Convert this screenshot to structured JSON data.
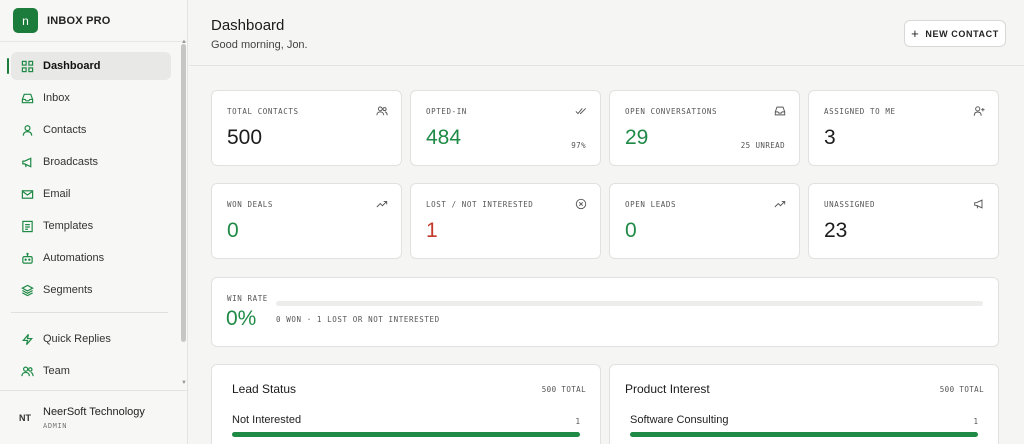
{
  "brand": {
    "logo_letter": "n",
    "name": "INBOX PRO"
  },
  "sidebar": {
    "items": [
      {
        "label": "Dashboard",
        "icon": "grid-icon",
        "active": true
      },
      {
        "label": "Inbox",
        "icon": "inbox-icon"
      },
      {
        "label": "Contacts",
        "icon": "user-icon"
      },
      {
        "label": "Broadcasts",
        "icon": "megaphone-icon"
      },
      {
        "label": "Email",
        "icon": "mail-icon"
      },
      {
        "label": "Templates",
        "icon": "template-icon"
      },
      {
        "label": "Automations",
        "icon": "bot-icon"
      },
      {
        "label": "Segments",
        "icon": "layers-icon"
      },
      {
        "label": "Quick Replies",
        "icon": "zap-icon"
      },
      {
        "label": "Team",
        "icon": "users-icon"
      }
    ],
    "user": {
      "initials": "NT",
      "name": "NeerSoft Technology",
      "role": "ADMIN"
    }
  },
  "header": {
    "title": "Dashboard",
    "greeting": "Good morning, Jon.",
    "new_contact_label": "NEW CONTACT"
  },
  "stats": {
    "total_contacts": {
      "label": "TOTAL CONTACTS",
      "value": "500",
      "icon": "users-icon"
    },
    "opted_in": {
      "label": "OPTED-IN",
      "value": "484",
      "sub": "97%",
      "icon": "double-check-icon"
    },
    "open_conversations": {
      "label": "OPEN CONVERSATIONS",
      "value": "29",
      "sub": "25 UNREAD",
      "icon": "inbox-icon"
    },
    "assigned_to_me": {
      "label": "ASSIGNED TO ME",
      "value": "3",
      "icon": "user-plus-icon"
    },
    "won_deals": {
      "label": "WON DEALS",
      "value": "0",
      "icon": "trend-up-icon"
    },
    "lost": {
      "label": "LOST / NOT INTERESTED",
      "value": "1",
      "icon": "x-circle-icon"
    },
    "open_leads": {
      "label": "OPEN LEADS",
      "value": "0",
      "icon": "trend-up-icon"
    },
    "unassigned": {
      "label": "UNASSIGNED",
      "value": "23",
      "icon": "megaphone-icon"
    }
  },
  "win_rate": {
    "label": "WIN RATE",
    "value": "0%",
    "fill_fraction": 0,
    "detail": "0 WON · 1 LOST OR NOT INTERESTED"
  },
  "lead_status": {
    "title": "Lead Status",
    "total": "500 TOTAL",
    "rows": [
      {
        "label": "Not Interested",
        "count": "1",
        "fill_fraction": 1
      }
    ]
  },
  "product_interest": {
    "title": "Product Interest",
    "total": "500 TOTAL",
    "rows": [
      {
        "label": "Software Consulting",
        "count": "1",
        "fill_fraction": 1
      }
    ]
  },
  "colors": {
    "accent": "#1f8a46",
    "brand": "#1c7c3c",
    "danger": "#c0392b"
  }
}
